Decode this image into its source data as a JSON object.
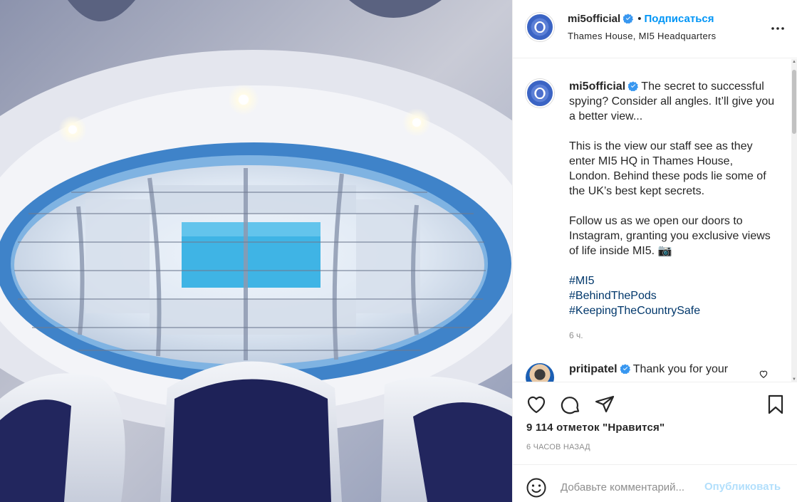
{
  "post": {
    "username": "mi5official",
    "verified": true,
    "follow_label": "Подписаться",
    "location": "Thames House, MI5 Headquarters"
  },
  "caption": {
    "username": "mi5official",
    "para1": "The secret to successful spying? Consider all angles. It’ll give you a better view...",
    "para2": "This is the view our staff see as they enter MI5 HQ in Thames House, London. Behind these pods lie some of the UK’s best kept secrets.",
    "para3": "Follow us as we open our doors to Instagram, granting you exclusive views of life inside MI5. 📷",
    "hashtags": [
      "#MI5",
      "#BehindThePods",
      "#KeepingTheCountrySafe"
    ],
    "time": "6 ч."
  },
  "comment": {
    "username": "pritipatel",
    "text": "Thank you for your"
  },
  "stats": {
    "likes": "9 114 отметок \"Нравится\"",
    "posted": "6 ЧАСОВ НАЗАД"
  },
  "add_comment": {
    "placeholder": "Добавьте комментарий...",
    "publish_label": "Опубликовать"
  },
  "icons": {
    "more": "more-horizontal-icon",
    "like": "heart-icon",
    "comment": "comment-bubble-icon",
    "share": "paper-plane-icon",
    "save": "bookmark-icon",
    "emoji": "smiley-icon",
    "verified": "verified-badge-icon"
  },
  "colors": {
    "accent": "#0095f6",
    "hashtag": "#00376b",
    "muted": "#8e8e8e",
    "publish_disabled": "#b2dffc"
  }
}
